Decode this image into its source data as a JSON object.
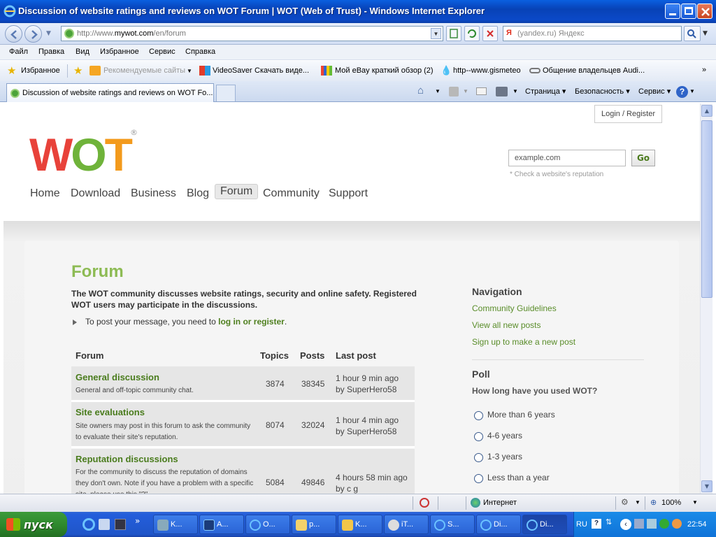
{
  "window": {
    "title": "Discussion of website ratings and reviews on WOT Forum | WOT (Web of Trust) - Windows Internet Explorer"
  },
  "address_bar": {
    "url_prefix": "http://www.",
    "url_domain": "mywot.com",
    "url_path": "/en/forum",
    "search_placeholder": "(yandex.ru) Яндекс"
  },
  "menu": [
    "Файл",
    "Правка",
    "Вид",
    "Избранное",
    "Сервис",
    "Справка"
  ],
  "favorites_bar": {
    "favorites_label": "Избранное",
    "items": [
      "Рекомендуемые сайты",
      "VideoSaver",
      "Скачать виде...",
      "Мой eBay краткий обзор (2)",
      "http--www.gismeteo",
      "Общение владельцев Audi..."
    ]
  },
  "tabs": {
    "active_tab": "Discussion of website ratings and reviews on WOT Fo...",
    "commands": [
      "Страница",
      "Безопасность",
      "Сервис"
    ]
  },
  "page": {
    "login_label": "Login / Register",
    "logo_text": "WOT",
    "logo_mark": "®",
    "nav": [
      "Home",
      "Download",
      "Business",
      "Blog",
      "Forum",
      "Community",
      "Support"
    ],
    "active_nav": "Forum",
    "site_input_value": "example.com",
    "go_label": "Go",
    "hint": "* Check a website's reputation",
    "heading": "Forum",
    "intro": "The WOT community discusses website ratings, security and online safety. Registered WOT users may participate in the discussions.",
    "to_post_text": "To post your message, you need to",
    "to_post_link": "log in or register",
    "to_post_end": ".",
    "table_headers": {
      "forum": "Forum",
      "topics": "Topics",
      "posts": "Posts",
      "last_post": "Last post"
    },
    "forums": [
      {
        "name": "General discussion",
        "desc": "General and off-topic community chat.",
        "topics": "3874",
        "posts": "38345",
        "last_time": "1 hour 9 min ago",
        "last_by": "by SuperHero58"
      },
      {
        "name": "Site evaluations",
        "desc": "Site owners may post in this forum to ask the community to evaluate their site's reputation.",
        "topics": "8074",
        "posts": "32024",
        "last_time": "1 hour 4 min ago",
        "last_by": "by SuperHero58"
      },
      {
        "name": "Reputation discussions",
        "desc": "For the community to discuss the reputation of domains they don't own. Note if you have a problem with a specific site, please use this \"?\"",
        "topics": "5084",
        "posts": "49846",
        "last_time": "4 hours 58 min ago",
        "last_by": "by c g"
      }
    ],
    "sidebar": {
      "nav_title": "Navigation",
      "nav_links": [
        "Community Guidelines",
        "View all new posts",
        "Sign up to make a new post"
      ],
      "poll_title": "Poll",
      "poll_question": "How long have you used WOT?",
      "poll_options": [
        "More than 6 years",
        "4-6 years",
        "1-3 years",
        "Less than a year"
      ]
    }
  },
  "status_bar": {
    "zone": "Интернет",
    "zoom": "100%"
  },
  "taskbar": {
    "start": "пуск",
    "tasks": [
      "K...",
      "A...",
      "O...",
      "p...",
      "K...",
      "iT...",
      "S...",
      "Di...",
      "Di..."
    ],
    "lang": "RU",
    "clock": "22:54"
  },
  "colors": {
    "accent_green": "#8dbb54",
    "link_green": "#4e7f1e",
    "logo_red": "#e8423a",
    "logo_green": "#6fb33a",
    "logo_orange": "#f39a1c"
  }
}
